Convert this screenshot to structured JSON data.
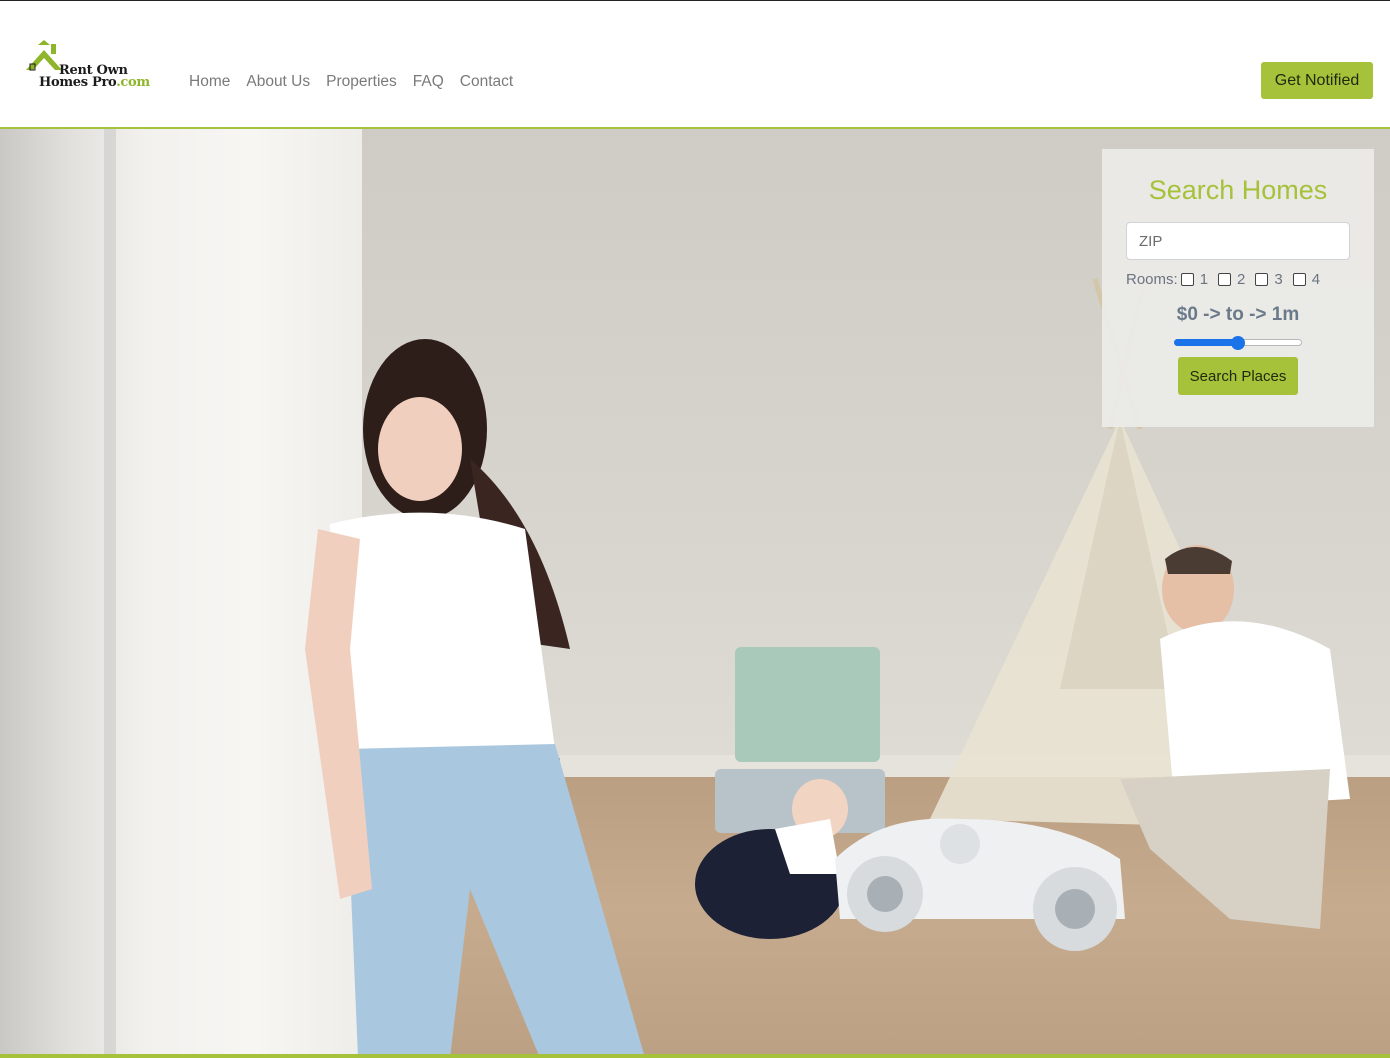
{
  "header": {
    "logo": {
      "line1": "Rent Own",
      "line2_a": "Homes Pro",
      "line2_b": ".com"
    },
    "nav": [
      {
        "label": "Home"
      },
      {
        "label": "About Us"
      },
      {
        "label": "Properties"
      },
      {
        "label": "FAQ"
      },
      {
        "label": "Contact"
      }
    ],
    "cta_label": "Get Notified"
  },
  "search": {
    "title": "Search Homes",
    "zip_placeholder": "ZIP",
    "rooms_label": "Rooms:",
    "rooms": [
      {
        "label": "1",
        "checked": false
      },
      {
        "label": "2",
        "checked": false
      },
      {
        "label": "3",
        "checked": false
      },
      {
        "label": "4",
        "checked": false
      }
    ],
    "price_text": "$0 -> to -> 1m",
    "slider_fraction": 0.5,
    "button_label": "Search Places"
  },
  "colors": {
    "accent": "#a6c13a",
    "slider": "#1a73e8",
    "nav_text": "#7a7a7a"
  }
}
